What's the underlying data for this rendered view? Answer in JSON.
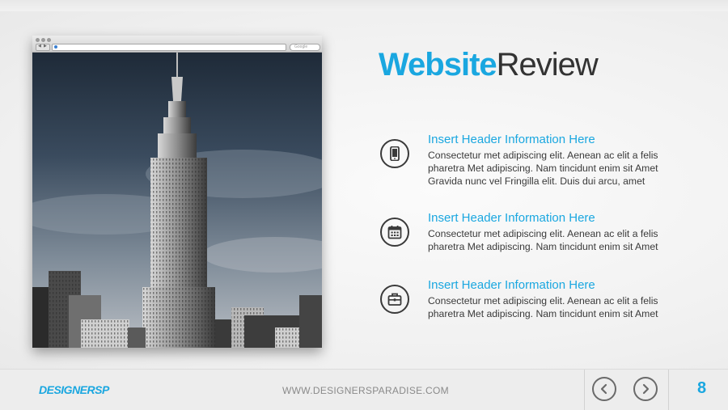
{
  "title": {
    "bold": "Website",
    "light": "Review"
  },
  "browser": {
    "search_placeholder": "Google"
  },
  "items": [
    {
      "icon": "mobile-phone-icon",
      "header": "Insert Header  Information Here",
      "lines": [
        "Consectetur  met adipiscing elit. Aenean ac elit a felis",
        "pharetra Met adipiscing. Nam tincidunt enim sit Amet",
        "Gravida nunc vel Fringilla elit. Duis dui arcu, amet"
      ]
    },
    {
      "icon": "calendar-icon",
      "header": "Insert Header  Information Here",
      "lines": [
        "Consectetur  met adipiscing elit. Aenean ac elit a felis",
        "pharetra Met adipiscing. Nam tincidunt enim sit Amet"
      ]
    },
    {
      "icon": "briefcase-icon",
      "header": "Insert Header  Information Here",
      "lines": [
        "Consectetur  met adipiscing elit. Aenean ac elit a felis",
        "pharetra Met adipiscing. Nam tincidunt enim sit Amet"
      ]
    }
  ],
  "footer": {
    "brand": "DESIGNERSP",
    "url": "WWW.DESIGNERSPARADISE.COM",
    "page_number": "8",
    "prev_icon": "chevron-left-icon",
    "next_icon": "chevron-right-icon"
  },
  "colors": {
    "accent": "#1aa7e0",
    "text": "#3a3a3a",
    "title_dark": "#333333"
  }
}
